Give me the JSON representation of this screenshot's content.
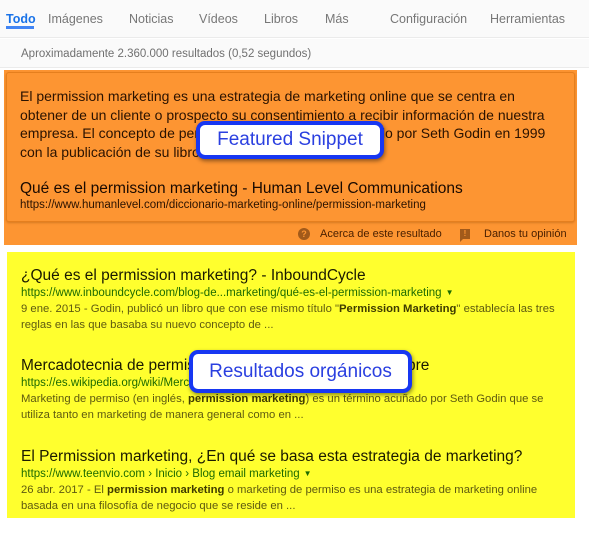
{
  "nav": {
    "tabs": [
      {
        "label": "Todo",
        "active": true
      },
      {
        "label": "Imágenes",
        "active": false
      },
      {
        "label": "Noticias",
        "active": false
      },
      {
        "label": "Vídeos",
        "active": false
      },
      {
        "label": "Libros",
        "active": false
      },
      {
        "label": "Más",
        "active": false
      }
    ],
    "settings_label": "Configuración",
    "tools_label": "Herramientas"
  },
  "stats": "Aproximadamente 2.360.000 resultados (0,52 segundos)",
  "featured_snippet": {
    "text": "El permission marketing es una estrategia de marketing online que se centra en obtener de un cliente o prospecto su consentimiento a recibir información de nuestra empresa. El concepto de permission marketing fue acuñado por Seth Godin en 1999 con la publicación de su libro.",
    "title": "Qué es el permission marketing - Human Level Communications",
    "url": "https://www.humanlevel.com/diccionario-marketing-online/permission-marketing",
    "about_label": "Acerca de este resultado",
    "feedback_label": "Danos tu opinión",
    "about_icon": "question-icon",
    "feedback_icon": "feedback-icon",
    "highlight_color": "#fd9532"
  },
  "organic": {
    "highlight_color": "#ffff2e",
    "results": [
      {
        "title": "¿Qué es el permission marketing? - InboundCycle",
        "url": "https://www.inboundcycle.com/blog-de...marketing/qué-es-el-permission-marketing",
        "snippet_pre": "9 ene. 2015 - Godin, publicó un libro que con ese mismo título \"",
        "snippet_bold": "Permission Marketing",
        "snippet_post": "\" establecía las tres reglas en las que basaba su nuevo concepto de ..."
      },
      {
        "title": "Mercadotecnia de permiso - Wikipedia, la enciclopedia libre",
        "url": "https://es.wikipedia.org/wiki/Mercadotecnia_de_permiso",
        "snippet_pre": "Marketing de permiso (en inglés, ",
        "snippet_bold": "permission marketing",
        "snippet_post": ") es un término acuñado por Seth Godin que se utiliza tanto en marketing de manera general como en ..."
      },
      {
        "title": "El Permission marketing, ¿En qué se basa esta estrategia de marketing?",
        "url": "https://www.teenvio.com › Inicio › Blog email marketing",
        "snippet_pre": "26 abr. 2017 - El ",
        "snippet_bold": "permission marketing",
        "snippet_post": " o marketing de permiso es una estrategia de marketing online basada en una filosofía de negocio que se reside en ..."
      }
    ]
  },
  "callouts": {
    "featured": "Featured Snippet",
    "organic": "Resultados orgánicos",
    "border_color": "#1737f2"
  }
}
